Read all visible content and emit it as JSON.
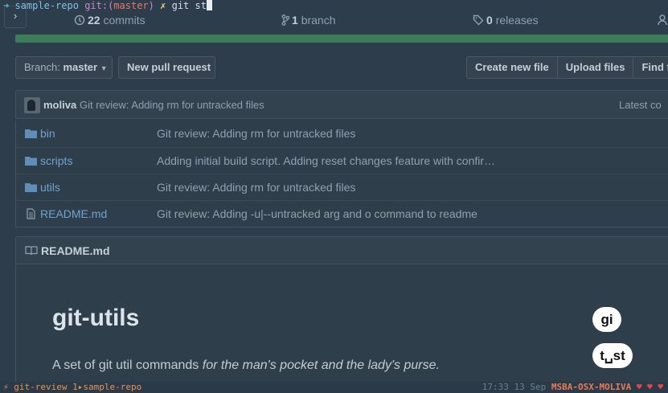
{
  "terminal": {
    "arrow": "➜",
    "repo": "sample-repo",
    "git_label": "git:(",
    "branch": "master",
    "git_close": ")",
    "dirty_mark": "✗",
    "command": "git st"
  },
  "repo_stats": {
    "commits_count": "22",
    "commits_label": "commits",
    "branches_count": "1",
    "branches_label": "branch",
    "releases_count": "0",
    "releases_label": "releases"
  },
  "toolbar": {
    "branch_prefix": "Branch:",
    "branch_value": "master",
    "new_pull_request": "New pull request",
    "create_new_file": "Create new file",
    "upload_files": "Upload files",
    "find_file": "Find file"
  },
  "latest_commit": {
    "user": "moliva",
    "message": "Git review: Adding rm for untracked files",
    "latest_label": "Latest co"
  },
  "files": [
    {
      "name": "bin",
      "type": "folder",
      "message": "Git review: Adding rm for untracked files"
    },
    {
      "name": "scripts",
      "type": "folder",
      "message": "Adding initial build script. Adding reset changes feature with confir…"
    },
    {
      "name": "utils",
      "type": "folder",
      "message": "Git review: Adding rm for untracked files"
    },
    {
      "name": "README.md",
      "type": "file",
      "message": "Git review: Adding -u|--untracked arg and o command to readme"
    }
  ],
  "readme": {
    "header": "README.md",
    "title": "git-utils",
    "intro_plain": "A set of git util commands ",
    "intro_italic": "for the man's pocket and the lady's purse."
  },
  "keystrokes": [
    "gi",
    "t␣st"
  ],
  "status_bar": {
    "left": "⚡ git-review 1▸sample-repo",
    "time": "17:33",
    "date": "13 Sep",
    "host": "MSBA-OSX-MOLIVA",
    "hearts": "♥ ♥ ♥"
  },
  "colors": {
    "background": "#2b3a48",
    "link": "#6fa3cf",
    "language_bar": "#3e7d5a"
  }
}
